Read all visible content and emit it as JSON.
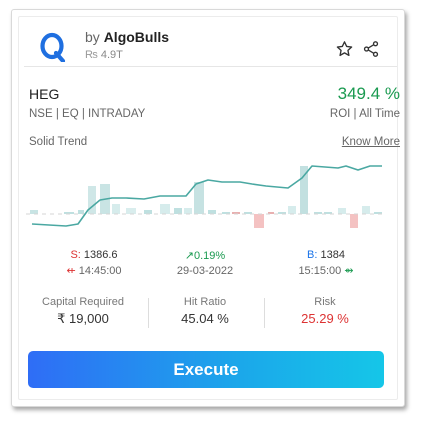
{
  "header": {
    "by": "by",
    "brand": "AlgoBulls",
    "rating_icon": "rupee-icon",
    "rating_value": "4.9T",
    "icons": [
      "star-outline-icon",
      "share-icon"
    ]
  },
  "strategy": {
    "symbol": "HEG",
    "subtitle": "NSE | EQ | INTRADAY",
    "roi_value": "349.4 %",
    "roi_label": "ROI | All Time",
    "trend_label": "Solid Trend",
    "know_more": "Know More"
  },
  "trade": {
    "sell_key": "S:",
    "sell_price": "1386.6",
    "sell_time": "14:45:00",
    "change": "0.19%",
    "date": "29-03-2022",
    "buy_key": "B:",
    "buy_price": "1384",
    "buy_time": "15:15:00"
  },
  "metrics": {
    "capital_label": "Capital Required",
    "capital_value": "₹ 19,000",
    "hit_label": "Hit Ratio",
    "hit_value": "45.04 %",
    "risk_label": "Risk",
    "risk_value": "25.29 %"
  },
  "actions": {
    "execute": "Execute"
  },
  "colors": {
    "positive": "#1a9a50",
    "negative": "#d33333",
    "line": "#4aa8a2",
    "button_start": "#2f6df6",
    "button_end": "#15c6e8"
  }
}
